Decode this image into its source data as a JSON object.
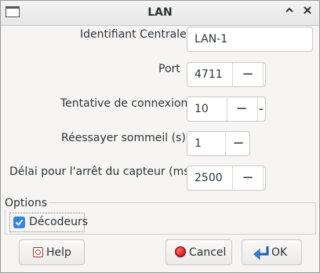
{
  "window": {
    "title": "LAN"
  },
  "form": {
    "identifiant_label": "Identifiant Centrale",
    "identifiant_value": "LAN-1",
    "port_label": "Port",
    "port_value": "4711",
    "tentative_label": "Tentative de connexion",
    "tentative_value": "10",
    "reessayer_label": "Réessayer sommeil (s)",
    "reessayer_value": "1",
    "delai_label": "Délai pour l'arrêt du capteur (ms)",
    "delai_value": "2500"
  },
  "options": {
    "legend": "Options",
    "decodeurs_label": "Décodeurs",
    "decodeurs_checked": true
  },
  "buttons": {
    "help": "Help",
    "cancel": "Cancel",
    "ok": "OK"
  },
  "icons": {
    "app": "window-icon",
    "minimize": "chevron-up-icon",
    "close": "close-icon",
    "help": "help-icon",
    "cancel": "cancel-icon",
    "ok": "ok-icon"
  }
}
